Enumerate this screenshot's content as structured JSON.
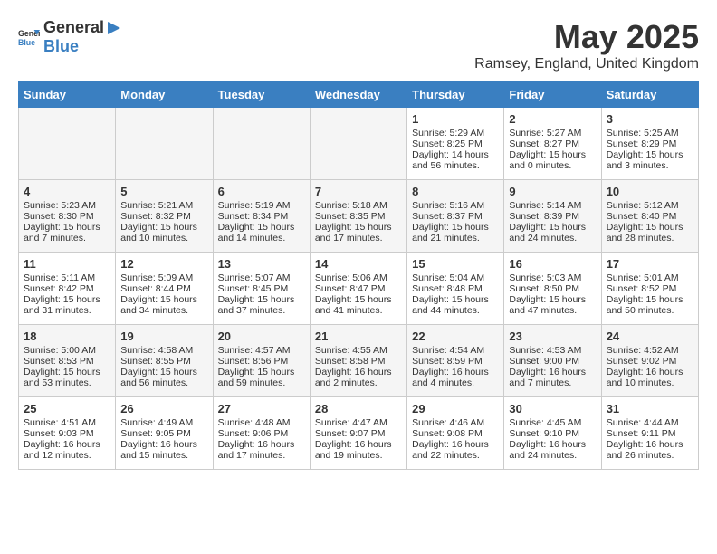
{
  "header": {
    "logo_general": "General",
    "logo_blue": "Blue",
    "title": "May 2025",
    "location": "Ramsey, England, United Kingdom"
  },
  "days_of_week": [
    "Sunday",
    "Monday",
    "Tuesday",
    "Wednesday",
    "Thursday",
    "Friday",
    "Saturday"
  ],
  "weeks": [
    [
      {
        "day": "",
        "info": ""
      },
      {
        "day": "",
        "info": ""
      },
      {
        "day": "",
        "info": ""
      },
      {
        "day": "",
        "info": ""
      },
      {
        "day": "1",
        "info": "Sunrise: 5:29 AM\nSunset: 8:25 PM\nDaylight: 14 hours and 56 minutes."
      },
      {
        "day": "2",
        "info": "Sunrise: 5:27 AM\nSunset: 8:27 PM\nDaylight: 15 hours and 0 minutes."
      },
      {
        "day": "3",
        "info": "Sunrise: 5:25 AM\nSunset: 8:29 PM\nDaylight: 15 hours and 3 minutes."
      }
    ],
    [
      {
        "day": "4",
        "info": "Sunrise: 5:23 AM\nSunset: 8:30 PM\nDaylight: 15 hours and 7 minutes."
      },
      {
        "day": "5",
        "info": "Sunrise: 5:21 AM\nSunset: 8:32 PM\nDaylight: 15 hours and 10 minutes."
      },
      {
        "day": "6",
        "info": "Sunrise: 5:19 AM\nSunset: 8:34 PM\nDaylight: 15 hours and 14 minutes."
      },
      {
        "day": "7",
        "info": "Sunrise: 5:18 AM\nSunset: 8:35 PM\nDaylight: 15 hours and 17 minutes."
      },
      {
        "day": "8",
        "info": "Sunrise: 5:16 AM\nSunset: 8:37 PM\nDaylight: 15 hours and 21 minutes."
      },
      {
        "day": "9",
        "info": "Sunrise: 5:14 AM\nSunset: 8:39 PM\nDaylight: 15 hours and 24 minutes."
      },
      {
        "day": "10",
        "info": "Sunrise: 5:12 AM\nSunset: 8:40 PM\nDaylight: 15 hours and 28 minutes."
      }
    ],
    [
      {
        "day": "11",
        "info": "Sunrise: 5:11 AM\nSunset: 8:42 PM\nDaylight: 15 hours and 31 minutes."
      },
      {
        "day": "12",
        "info": "Sunrise: 5:09 AM\nSunset: 8:44 PM\nDaylight: 15 hours and 34 minutes."
      },
      {
        "day": "13",
        "info": "Sunrise: 5:07 AM\nSunset: 8:45 PM\nDaylight: 15 hours and 37 minutes."
      },
      {
        "day": "14",
        "info": "Sunrise: 5:06 AM\nSunset: 8:47 PM\nDaylight: 15 hours and 41 minutes."
      },
      {
        "day": "15",
        "info": "Sunrise: 5:04 AM\nSunset: 8:48 PM\nDaylight: 15 hours and 44 minutes."
      },
      {
        "day": "16",
        "info": "Sunrise: 5:03 AM\nSunset: 8:50 PM\nDaylight: 15 hours and 47 minutes."
      },
      {
        "day": "17",
        "info": "Sunrise: 5:01 AM\nSunset: 8:52 PM\nDaylight: 15 hours and 50 minutes."
      }
    ],
    [
      {
        "day": "18",
        "info": "Sunrise: 5:00 AM\nSunset: 8:53 PM\nDaylight: 15 hours and 53 minutes."
      },
      {
        "day": "19",
        "info": "Sunrise: 4:58 AM\nSunset: 8:55 PM\nDaylight: 15 hours and 56 minutes."
      },
      {
        "day": "20",
        "info": "Sunrise: 4:57 AM\nSunset: 8:56 PM\nDaylight: 15 hours and 59 minutes."
      },
      {
        "day": "21",
        "info": "Sunrise: 4:55 AM\nSunset: 8:58 PM\nDaylight: 16 hours and 2 minutes."
      },
      {
        "day": "22",
        "info": "Sunrise: 4:54 AM\nSunset: 8:59 PM\nDaylight: 16 hours and 4 minutes."
      },
      {
        "day": "23",
        "info": "Sunrise: 4:53 AM\nSunset: 9:00 PM\nDaylight: 16 hours and 7 minutes."
      },
      {
        "day": "24",
        "info": "Sunrise: 4:52 AM\nSunset: 9:02 PM\nDaylight: 16 hours and 10 minutes."
      }
    ],
    [
      {
        "day": "25",
        "info": "Sunrise: 4:51 AM\nSunset: 9:03 PM\nDaylight: 16 hours and 12 minutes."
      },
      {
        "day": "26",
        "info": "Sunrise: 4:49 AM\nSunset: 9:05 PM\nDaylight: 16 hours and 15 minutes."
      },
      {
        "day": "27",
        "info": "Sunrise: 4:48 AM\nSunset: 9:06 PM\nDaylight: 16 hours and 17 minutes."
      },
      {
        "day": "28",
        "info": "Sunrise: 4:47 AM\nSunset: 9:07 PM\nDaylight: 16 hours and 19 minutes."
      },
      {
        "day": "29",
        "info": "Sunrise: 4:46 AM\nSunset: 9:08 PM\nDaylight: 16 hours and 22 minutes."
      },
      {
        "day": "30",
        "info": "Sunrise: 4:45 AM\nSunset: 9:10 PM\nDaylight: 16 hours and 24 minutes."
      },
      {
        "day": "31",
        "info": "Sunrise: 4:44 AM\nSunset: 9:11 PM\nDaylight: 16 hours and 26 minutes."
      }
    ]
  ]
}
